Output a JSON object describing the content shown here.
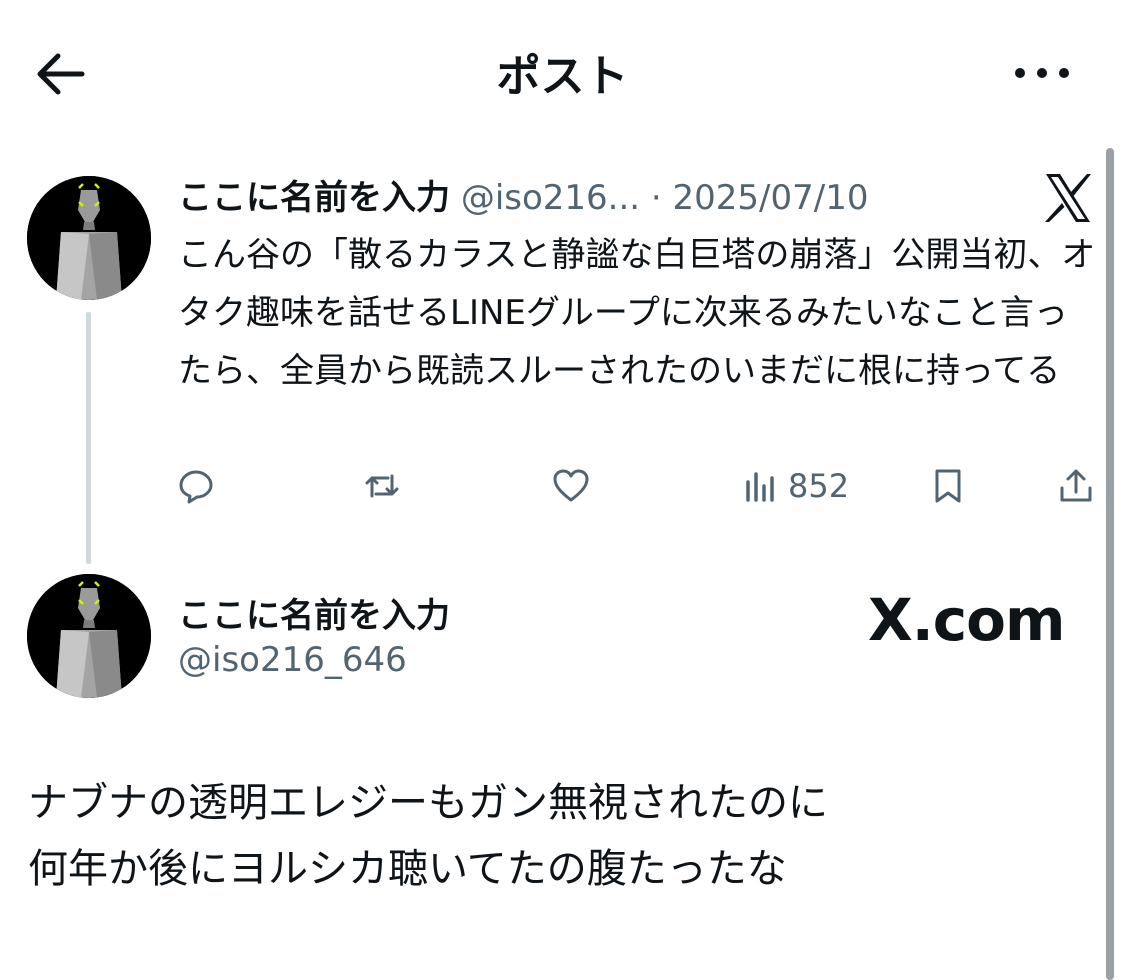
{
  "header": {
    "title": "ポスト",
    "back_icon": "arrow-left-icon",
    "more_icon": "more-horizontal-icon"
  },
  "quoted_tweet": {
    "display_name": "ここに名前を入力",
    "handle": "@iso216...",
    "separator": "·",
    "date": "2025/07/10",
    "platform_icon": "x-logo-icon",
    "text": "こん谷の「散るカラスと静謐な白巨塔の崩落」公開当初、オタク趣味を話せるLINEグループに次来るみたいなこと言ったら、全員から既読スルーされたのいまだに根に持ってる",
    "actions": {
      "reply_icon": "reply-icon",
      "retweet_icon": "retweet-icon",
      "like_icon": "heart-icon",
      "views_icon": "views-icon",
      "views_count": "852",
      "bookmark_icon": "bookmark-icon",
      "share_icon": "share-icon"
    }
  },
  "reply": {
    "display_name": "ここに名前を入力",
    "handle": "@iso216_646",
    "watermark": "X.com",
    "lines": [
      "ナブナの透明エレジーもガン無視されたのに",
      "何年か後にヨルシカ聴いてたの腹たったな"
    ]
  },
  "colors": {
    "text_primary": "#0f1419",
    "text_secondary": "#536471",
    "thread_line": "#cfd9de",
    "avatar_accent": "#d8f000"
  }
}
